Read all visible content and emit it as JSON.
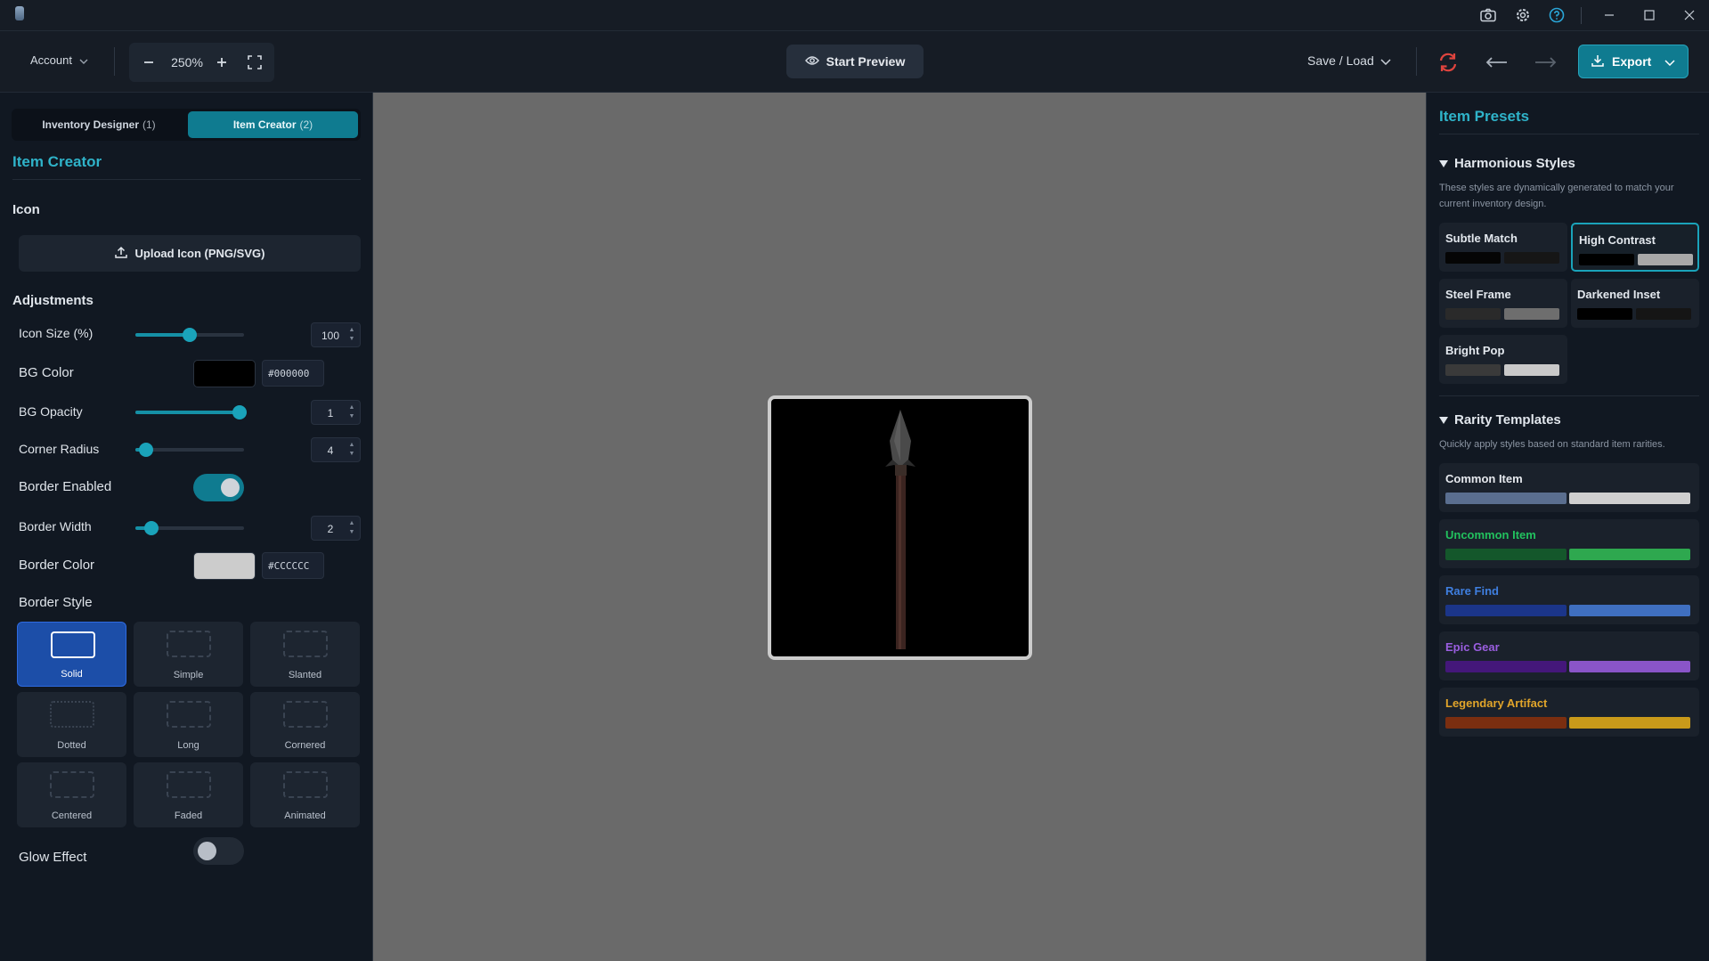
{
  "toolbar": {
    "account_label": "Account",
    "zoom_value": "250%",
    "preview_label": "Start Preview",
    "saveload_label": "Save / Load",
    "export_label": "Export"
  },
  "tabs": [
    {
      "label": "Inventory Designer",
      "count": "(1)"
    },
    {
      "label": "Item Creator",
      "count": "(2)"
    }
  ],
  "left_panel": {
    "title": "Item Creator",
    "icon_section": "Icon",
    "upload_label": "Upload Icon (PNG/SVG)",
    "adjustments_section": "Adjustments",
    "icon_size": {
      "label": "Icon Size (%)",
      "value": "100",
      "level": 0.5
    },
    "bg_color": {
      "label": "BG Color",
      "hex": "#000000",
      "swatch": "#000000"
    },
    "bg_opacity": {
      "label": "BG Opacity",
      "value": "1",
      "level": 0.96
    },
    "corner_radius": {
      "label": "Corner Radius",
      "value": "4",
      "level": 0.1
    },
    "border_enabled": {
      "label": "Border Enabled",
      "on": true
    },
    "border_width": {
      "label": "Border Width",
      "value": "2",
      "level": 0.15
    },
    "border_color": {
      "label": "Border Color",
      "hex": "#CCCCCC",
      "swatch": "#cccccc"
    },
    "border_style_section": "Border Style",
    "border_styles": [
      "Solid",
      "Simple",
      "Slanted",
      "Dotted",
      "Long",
      "Cornered",
      "Centered",
      "Faded",
      "Animated"
    ],
    "selected_style": "Solid",
    "glow_effect": {
      "label": "Glow Effect",
      "on": false
    }
  },
  "right_panel": {
    "title": "Item Presets",
    "harmonious": {
      "title": "Harmonious Styles",
      "description": "These styles are dynamically generated to match your current inventory design.",
      "presets": [
        {
          "name": "Subtle Match",
          "c1": "#050505",
          "c2": "#161616"
        },
        {
          "name": "High Contrast",
          "c1": "#000000",
          "c2": "#a8a8a8"
        },
        {
          "name": "Steel Frame",
          "c1": "#2a2a2a",
          "c2": "#6e6e6e"
        },
        {
          "name": "Darkened Inset",
          "c1": "#000000",
          "c2": "#151515"
        },
        {
          "name": "Bright Pop",
          "c1": "#3a3a3a",
          "c2": "#c9c9c9"
        }
      ]
    },
    "rarity": {
      "title": "Rarity Templates",
      "description": "Quickly apply styles based on standard item rarities.",
      "templates": [
        {
          "name": "Common Item",
          "color": "#e6e9ee",
          "c1": "#5a6e8f",
          "c2": "#cfcfcf"
        },
        {
          "name": "Uncommon Item",
          "color": "#22c15e",
          "c1": "#14572b",
          "c2": "#2ea84f"
        },
        {
          "name": "Rare Find",
          "color": "#3f7fe0",
          "c1": "#1b3589",
          "c2": "#3f6fc0"
        },
        {
          "name": "Epic Gear",
          "color": "#9a5ee0",
          "c1": "#44177a",
          "c2": "#8a55c8"
        },
        {
          "name": "Legendary Artifact",
          "color": "#e1a52a",
          "c1": "#7a2e10",
          "c2": "#c99a1a"
        }
      ]
    }
  },
  "icons": [
    "app-icon",
    "camera-icon",
    "gear-icon",
    "help-icon",
    "minimize-icon",
    "maximize-icon",
    "close-icon",
    "chevron-down-icon",
    "zoom-out-icon",
    "zoom-in-icon",
    "fullscreen-icon",
    "eye-icon",
    "refresh-icon",
    "undo-arrow-icon",
    "redo-arrow-icon",
    "download-icon",
    "upload-icon",
    "spear-icon"
  ]
}
